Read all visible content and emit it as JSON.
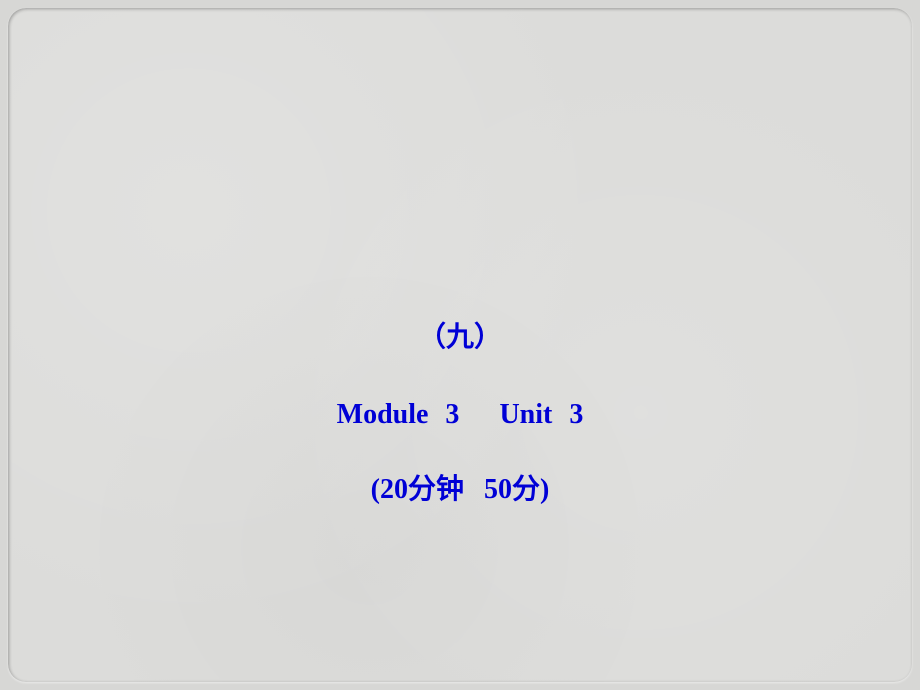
{
  "slide": {
    "title_cn": "（九）",
    "module_label": "Module 3",
    "unit_label": "Unit 3",
    "duration_label": "(20分钟",
    "score_label": "50分)"
  }
}
